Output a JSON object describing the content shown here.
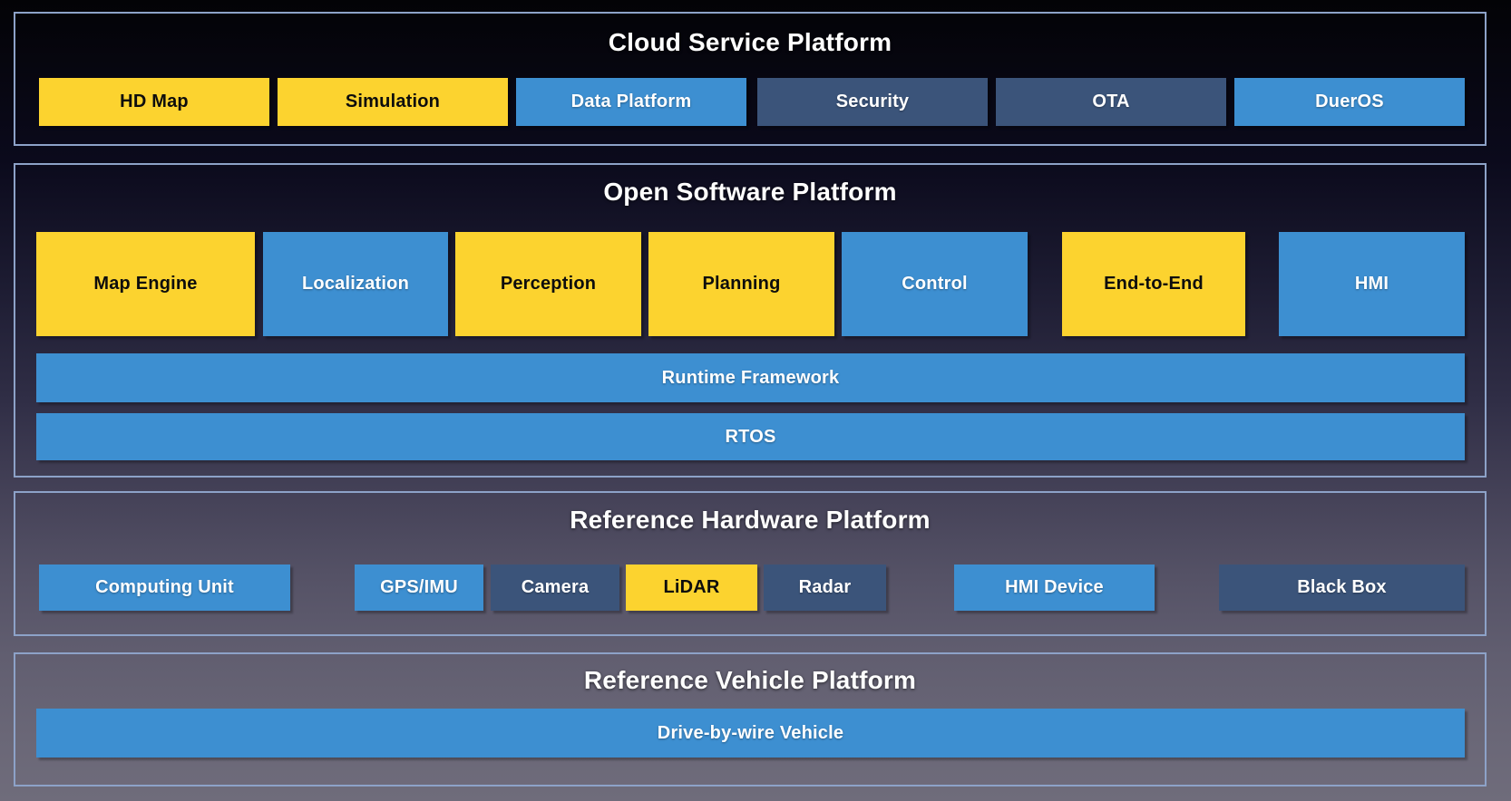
{
  "diagram_title_implicit": "Autonomous driving platform architecture",
  "colors": {
    "module_yellow": "#FCD32F",
    "module_blue": "#3D8FD1",
    "module_dark_slate": "#3B547A",
    "section_border": "#8DA2C8",
    "section_title_text": "#FFFFFF",
    "label_on_yellow": "#0D0D0D",
    "label_on_blue": "#FFFFFF",
    "background_top": "#030306",
    "background_bottom": "#6F6C7B"
  },
  "sections": [
    {
      "title": "Cloud Service Platform",
      "boxes": [
        {
          "label": "HD Map",
          "color": "yellow"
        },
        {
          "label": "Simulation",
          "color": "yellow"
        },
        {
          "label": "Data Platform",
          "color": "blue"
        },
        {
          "label": "Security",
          "color": "slate"
        },
        {
          "label": "OTA",
          "color": "slate"
        },
        {
          "label": "DuerOS",
          "color": "blue"
        }
      ]
    },
    {
      "title": "Open Software Platform",
      "boxes": [
        {
          "label": "Map Engine",
          "color": "yellow"
        },
        {
          "label": "Localization",
          "color": "blue"
        },
        {
          "label": "Perception",
          "color": "yellow"
        },
        {
          "label": "Planning",
          "color": "yellow"
        },
        {
          "label": "Control",
          "color": "blue"
        },
        {
          "label": "End-to-End",
          "color": "yellow"
        },
        {
          "label": "HMI",
          "color": "blue"
        }
      ],
      "bars": [
        {
          "label": "Runtime Framework",
          "color": "blue"
        },
        {
          "label": "RTOS",
          "color": "blue"
        }
      ]
    },
    {
      "title": "Reference Hardware Platform",
      "boxes": [
        {
          "label": "Computing Unit",
          "color": "blue"
        },
        {
          "label": "GPS/IMU",
          "color": "blue"
        },
        {
          "label": "Camera",
          "color": "slate"
        },
        {
          "label": "LiDAR",
          "color": "yellow"
        },
        {
          "label": "Radar",
          "color": "slate"
        },
        {
          "label": "HMI Device",
          "color": "blue"
        },
        {
          "label": "Black Box",
          "color": "slate"
        }
      ]
    },
    {
      "title": "Reference Vehicle Platform",
      "bars": [
        {
          "label": "Drive-by-wire Vehicle",
          "color": "blue"
        }
      ]
    }
  ]
}
